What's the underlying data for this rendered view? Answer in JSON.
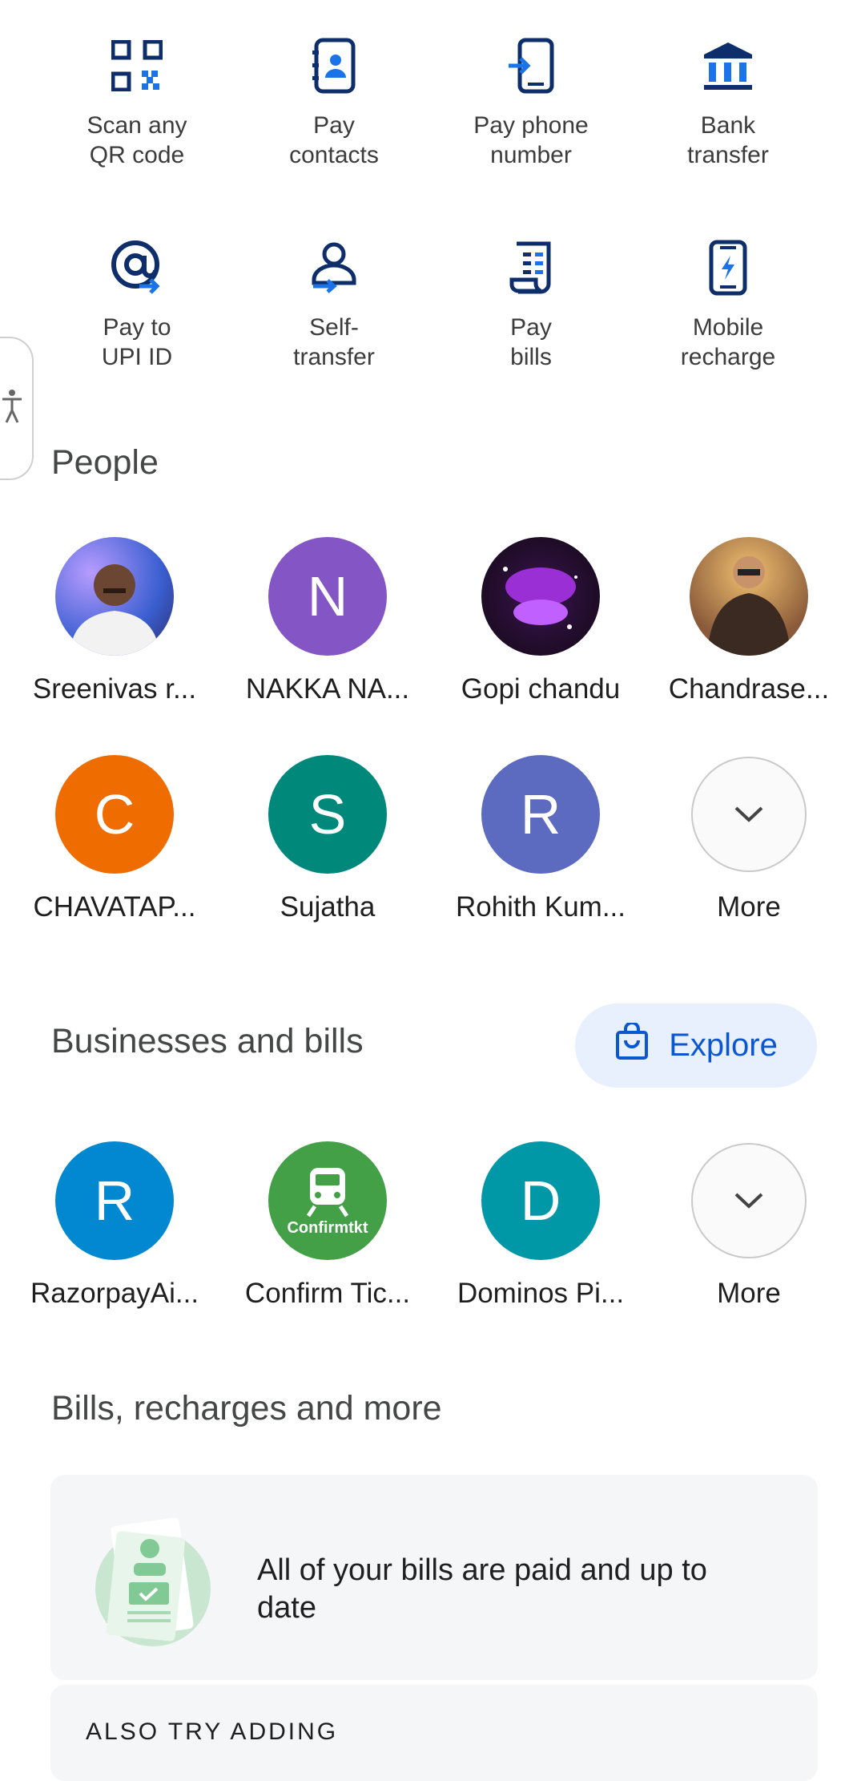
{
  "actions": [
    {
      "label": "Scan any\nQR code",
      "icon": "qr-code-icon"
    },
    {
      "label": "Pay\ncontacts",
      "icon": "contacts-book-icon"
    },
    {
      "label": "Pay phone\nnumber",
      "icon": "phone-transfer-icon"
    },
    {
      "label": "Bank\ntransfer",
      "icon": "bank-icon"
    },
    {
      "label": "Pay to\nUPI ID",
      "icon": "at-sign-icon"
    },
    {
      "label": "Self-\ntransfer",
      "icon": "self-transfer-icon"
    },
    {
      "label": "Pay\nbills",
      "icon": "bill-icon"
    },
    {
      "label": "Mobile\nrecharge",
      "icon": "mobile-recharge-icon"
    }
  ],
  "people": {
    "title": "People",
    "items": [
      {
        "name": "Sreenivas r...",
        "initial": "",
        "color": "#7a6a9c"
      },
      {
        "name": "NAKKA NA...",
        "initial": "N",
        "color": "#8455c5"
      },
      {
        "name": "Gopi chandu",
        "initial": "",
        "color": "#1a0b1f"
      },
      {
        "name": "Chandrase...",
        "initial": "",
        "color": "#8a5a3a"
      },
      {
        "name": "CHAVATAP...",
        "initial": "C",
        "color": "#ee6c00"
      },
      {
        "name": "Sujatha",
        "initial": "S",
        "color": "#00897b"
      },
      {
        "name": "Rohith Kum...",
        "initial": "R",
        "color": "#5c6bc0"
      }
    ],
    "more_label": "More"
  },
  "businesses": {
    "title": "Businesses and bills",
    "explore_label": "Explore",
    "items": [
      {
        "name": "RazorpayAi...",
        "initial": "R",
        "color": "#0288d1"
      },
      {
        "name": "Confirm Tic...",
        "initial": "",
        "logo_text": "Confirmtkt",
        "color": "#43a047"
      },
      {
        "name": "Dominos Pi...",
        "initial": "D",
        "color": "#0097a7"
      }
    ],
    "more_label": "More"
  },
  "bills": {
    "title": "Bills, recharges and more",
    "status_text": "All of your bills are paid and up to date",
    "also_try": "ALSO TRY ADDING"
  },
  "colors": {
    "icon_dark": "#0d2d6b",
    "icon_blue": "#1a73e8"
  }
}
